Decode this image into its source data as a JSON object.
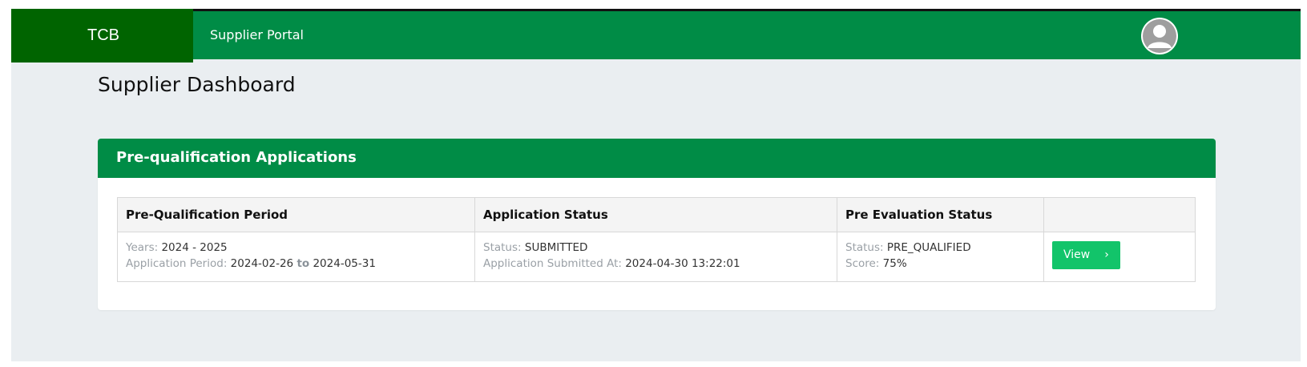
{
  "header": {
    "brand": "TCB",
    "portal_title": "Supplier Portal",
    "avatar_icon": "user-avatar-icon"
  },
  "page": {
    "title": "Supplier Dashboard"
  },
  "card": {
    "title": "Pre-qualification Applications",
    "columns": [
      "Pre-Qualification Period",
      "Application Status",
      "Pre Evaluation Status",
      ""
    ],
    "rows": [
      {
        "years_label": "Years:",
        "years_value": "2024 - 2025",
        "period_label": "Application Period:",
        "period_start": "2024-02-26",
        "period_to": "to",
        "period_end": "2024-05-31",
        "status_label": "Status:",
        "status_value": "SUBMITTED",
        "submitted_label": "Application Submitted At:",
        "submitted_value": "2024-04-30 13:22:01",
        "eval_status_label": "Status:",
        "eval_status_value": "PRE_QUALIFIED",
        "score_label": "Score:",
        "score_value": "75%",
        "view_label": "View",
        "view_icon": "chevron-right-icon"
      }
    ]
  },
  "colors": {
    "primary_green": "#008c46",
    "brand_green": "#006400",
    "button_green": "#12c46a",
    "page_bg": "#eaeef1"
  }
}
